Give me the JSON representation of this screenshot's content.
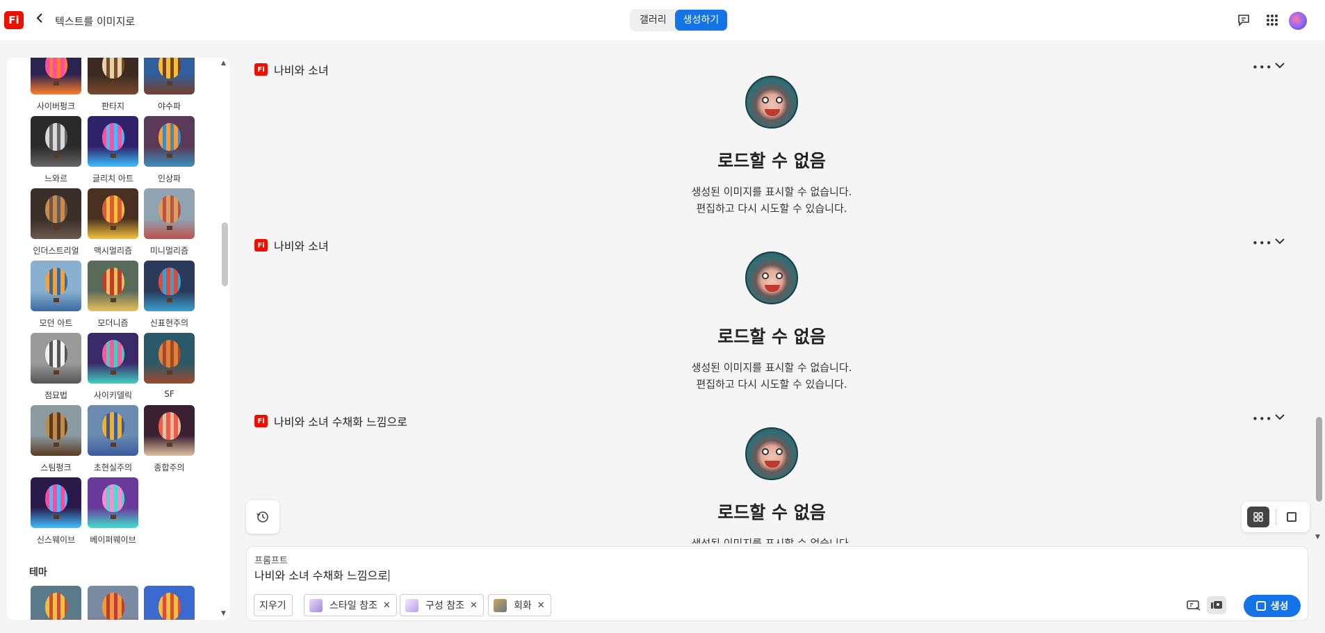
{
  "header": {
    "logo": "Fi",
    "back_icon": "chevron-left-icon",
    "app_title": "텍스트를 이미지로",
    "tabs": [
      "갤러리",
      "생성하기"
    ],
    "active_tab": "생성하기",
    "icons": [
      "feedback-icon",
      "apps-grid-icon",
      "avatar"
    ]
  },
  "styles_panel": {
    "tiles": [
      {
        "label": "사이버펑크",
        "colors": [
          "#2b2350",
          "#ff4da6",
          "#ff7f2a"
        ]
      },
      {
        "label": "판타지",
        "colors": [
          "#3a2a20",
          "#e7d2a8",
          "#7a4a2a"
        ]
      },
      {
        "label": "야수파",
        "colors": [
          "#2f5f9f",
          "#f2c230",
          "#7a3f2a"
        ]
      },
      {
        "label": "느와르",
        "colors": [
          "#2a2a2a",
          "#d8d8d8",
          "#666666"
        ]
      },
      {
        "label": "글리치 아트",
        "colors": [
          "#30226a",
          "#ff4fa0",
          "#3ac0ff"
        ]
      },
      {
        "label": "인상파",
        "colors": [
          "#5a3a58",
          "#ff9a3a",
          "#3a8fbf"
        ]
      },
      {
        "label": "인더스트리얼",
        "colors": [
          "#3a2e28",
          "#c98a4a",
          "#6a5a50"
        ]
      },
      {
        "label": "맥시멀리즘",
        "colors": [
          "#4a3020",
          "#e05a3a",
          "#f2c23a"
        ]
      },
      {
        "label": "미니멀리즘",
        "colors": [
          "#8fa3b3",
          "#d9a25a",
          "#c0504a"
        ]
      },
      {
        "label": "모던 아트",
        "colors": [
          "#8ab0d0",
          "#f2a23a",
          "#3a6aa0"
        ]
      },
      {
        "label": "모더니즘",
        "colors": [
          "#5a6a5a",
          "#c23a2a",
          "#e8c05a"
        ]
      },
      {
        "label": "신표현주의",
        "colors": [
          "#2a3a5a",
          "#e04a3a",
          "#3aa0d0"
        ]
      },
      {
        "label": "점묘법",
        "colors": [
          "#9a9a9a",
          "#f0f0f0",
          "#555555"
        ]
      },
      {
        "label": "사이키델릭",
        "colors": [
          "#3a2a6a",
          "#ff5aa0",
          "#40d0c0"
        ]
      },
      {
        "label": "SF",
        "colors": [
          "#2a5a6a",
          "#e0803a",
          "#a04a2a"
        ]
      },
      {
        "label": "스팀펑크",
        "colors": [
          "#8a9aa0",
          "#c08a4a",
          "#5a3a20"
        ]
      },
      {
        "label": "초현실주의",
        "colors": [
          "#6a8ab0",
          "#f0b030",
          "#3a5aa0"
        ]
      },
      {
        "label": "종합주의",
        "colors": [
          "#3a2030",
          "#f05a4a",
          "#e0c0a0"
        ]
      },
      {
        "label": "신스웨이브",
        "colors": [
          "#2a1a4a",
          "#ff4aa0",
          "#40c0ff"
        ]
      },
      {
        "label": "베이퍼웨이브",
        "colors": [
          "#6a3a9a",
          "#ff8ad0",
          "#40e0d0"
        ]
      }
    ],
    "section_title": "테마",
    "theme_tiles": [
      {
        "label": "",
        "colors": [
          "#5a7a8a",
          "#f0c040",
          "#d04a3a"
        ]
      },
      {
        "label": "",
        "colors": [
          "#7a8aa0",
          "#f09a3a",
          "#c03a3a"
        ]
      },
      {
        "label": "",
        "colors": [
          "#3a6ad0",
          "#f0c040",
          "#e04a3a"
        ]
      }
    ]
  },
  "feed": {
    "results": [
      {
        "title": "나비와 소녀",
        "error_title": "로드할 수 없음",
        "error_line1": "생성된 이미지를 표시할 수 없습니다.",
        "error_line2": "편집하고 다시 시도할 수 있습니다."
      },
      {
        "title": "나비와 소녀",
        "error_title": "로드할 수 없음",
        "error_line1": "생성된 이미지를 표시할 수 없습니다.",
        "error_line2": "편집하고 다시 시도할 수 있습니다."
      },
      {
        "title": "나비와 소녀 수채화 느낌으로",
        "error_title": "로드할 수 없음",
        "error_line1": "생성된 이미지를 표시할 수 없습니다.",
        "error_line2": ""
      }
    ]
  },
  "prompt": {
    "label": "프롬프트",
    "value": "나비와 소녀 수채화 느낌으로",
    "clear_label": "지우기",
    "chips": [
      {
        "label": "스타일 참조",
        "icon_color": "#b9a4e8"
      },
      {
        "label": "구성 참조",
        "icon_color": "#c8b4f0"
      },
      {
        "label": "회화",
        "icon_color": "#8a6a3a"
      }
    ],
    "generate_label": "생성"
  },
  "colors": {
    "accent": "#1473e6",
    "brand": "#eb1000"
  }
}
